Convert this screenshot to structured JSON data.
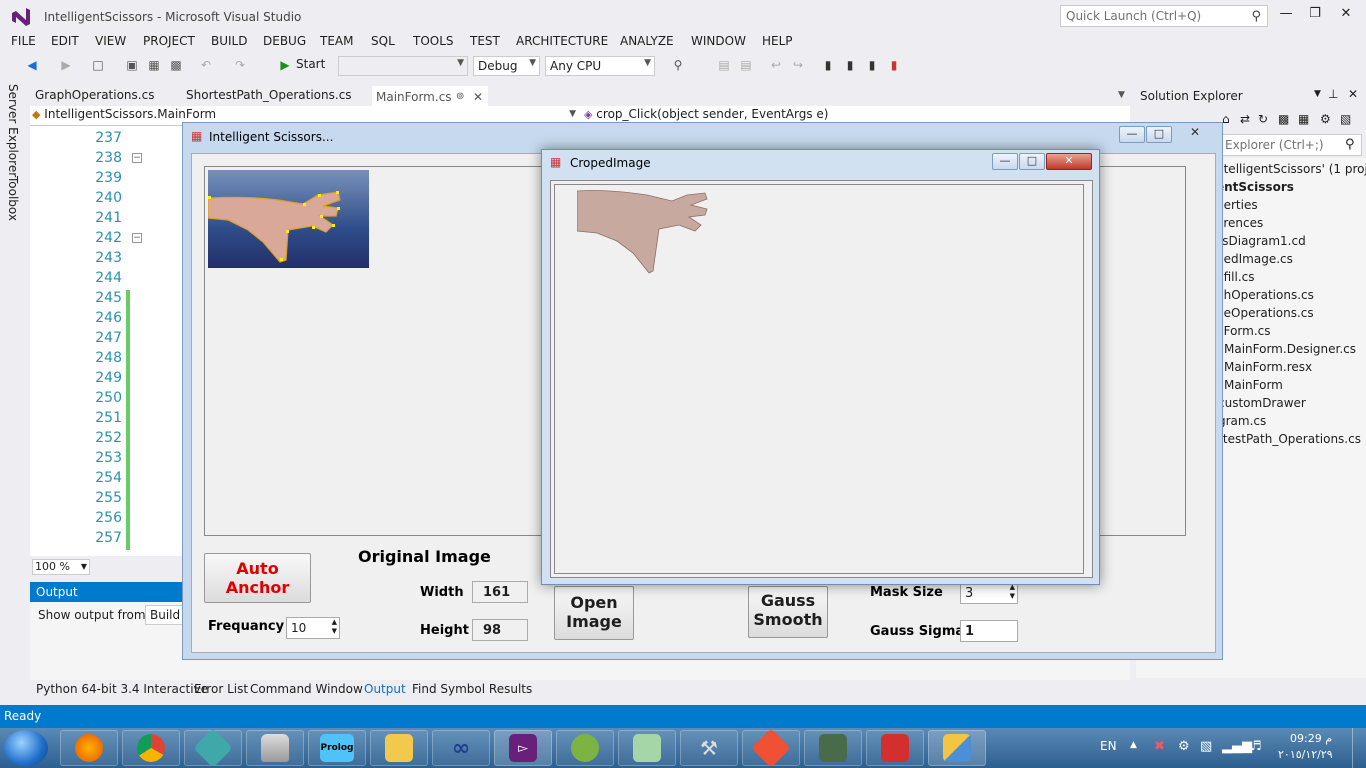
{
  "vs": {
    "title": "IntelligentScissors - Microsoft Visual Studio",
    "quick_launch_placeholder": "Quick Launch (Ctrl+Q)",
    "menu": [
      "FILE",
      "EDIT",
      "VIEW",
      "PROJECT",
      "BUILD",
      "DEBUG",
      "TEAM",
      "SQL",
      "TOOLS",
      "TEST",
      "ARCHITECTURE",
      "ANALYZE",
      "WINDOW",
      "HELP"
    ],
    "toolbar": {
      "start_label": "Start",
      "config": "Debug",
      "platform": "Any CPU"
    },
    "side_tabs": [
      "Server Explorer",
      "Toolbox"
    ],
    "doc_tabs": [
      "GraphOperations.cs",
      "ShortestPath_Operations.cs",
      "MainForm.cs"
    ],
    "nav": {
      "class_combo": "IntelligentScissors.MainForm",
      "member_combo": "crop_Click(object sender, EventArgs e)"
    },
    "line_numbers": [
      "237",
      "238",
      "239",
      "240",
      "241",
      "242",
      "243",
      "244",
      "245",
      "246",
      "247",
      "248",
      "249",
      "250",
      "251",
      "252",
      "253",
      "254",
      "255",
      "256",
      "257"
    ],
    "zoom": "100 %",
    "output": {
      "title": "Output",
      "show_from_label": "Show output from:",
      "source": "Build"
    },
    "bottom_tabs": [
      "Python 64-bit 3.4 Interactive",
      "Error List",
      "Command Window",
      "Output",
      "Find Symbol Results"
    ],
    "solution_explorer": {
      "title": "Solution Explorer",
      "search_placeholder": "Explorer (Ctrl+;)",
      "items": [
        "ntelligentScissors' (1 proje",
        "entScissors",
        "perties",
        "erences",
        "ssDiagram1.cd",
        "pedImage.cs",
        "dfill.cs",
        "phOperations.cs",
        "geOperations.cs",
        "nForm.cs",
        "MainForm.Designer.cs",
        "MainForm.resx",
        "MainForm",
        "customDrawer",
        "gram.cs",
        "rtestPath_Operations.cs"
      ]
    },
    "status": "Ready"
  },
  "main_form": {
    "title": "Intelligent Scissors...",
    "auto_anchor": "Auto Anchor",
    "frequency_label": "Frequancy",
    "frequency_value": "10",
    "original_image_label": "Original Image",
    "width_label": "Width",
    "width_value": "161",
    "height_label": "Height",
    "height_value": "98",
    "open_image": "Open Image",
    "gauss_smooth": "Gauss Smooth",
    "mask_size_label": "Mask Size",
    "mask_size_value": "3",
    "gauss_sigma_label": "Gauss Sigma",
    "gauss_sigma_value": "1"
  },
  "crop_form": {
    "title": "CropedImage"
  },
  "taskbar": {
    "apps": [
      "firefox",
      "chrome",
      "app",
      "database",
      "prolog",
      "explorer",
      "infinity",
      "visual-studio",
      "eclipse",
      "notepad",
      "tools",
      "git",
      "terminal",
      "acrobat",
      "forms"
    ],
    "prolog_label": "Prolog",
    "lang": "EN",
    "time": "09:29 م",
    "date": "٢٠١٥/١٢/٢٩"
  }
}
